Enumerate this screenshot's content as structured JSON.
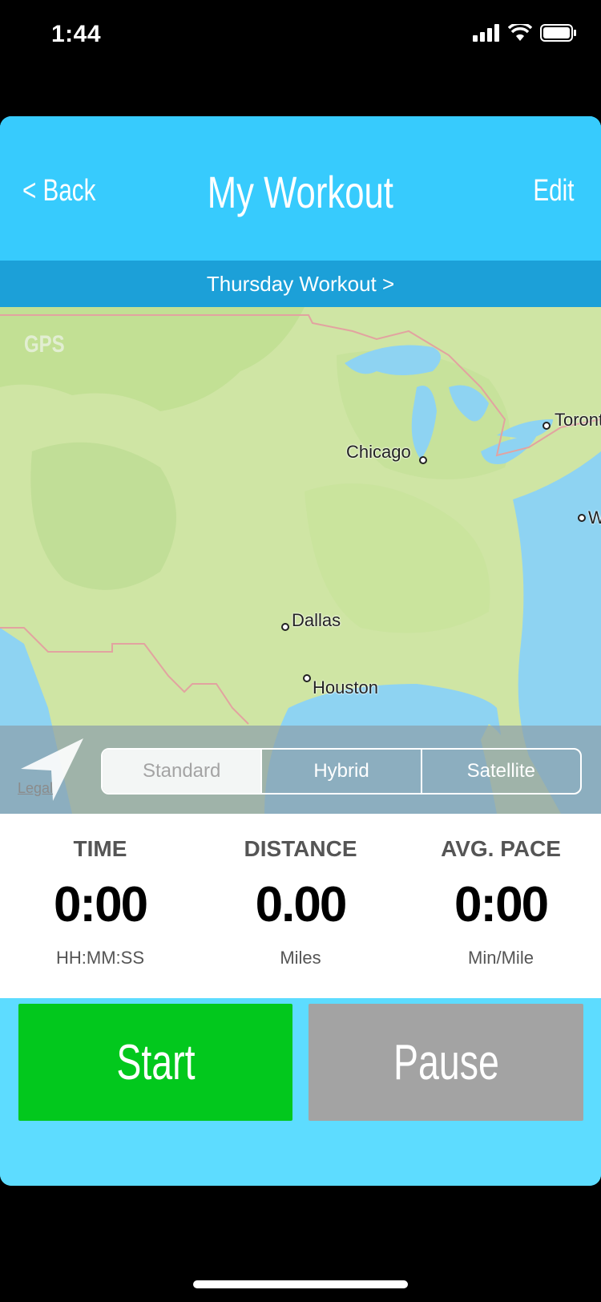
{
  "status_bar": {
    "time": "1:44",
    "icons": [
      "signal-icon",
      "wifi-icon",
      "battery-icon"
    ]
  },
  "nav": {
    "back_label": "< Back",
    "title": "My Workout",
    "edit_label": "Edit"
  },
  "workout_selector": {
    "label": "Thursday Workout >"
  },
  "map": {
    "gps_label": "GPS",
    "cities": [
      "Chicago",
      "Toronto",
      "Dallas",
      "Houston",
      "W"
    ],
    "legal_label": "Legal",
    "map_types": [
      "Standard",
      "Hybrid",
      "Satellite"
    ],
    "selected_map_type": "Standard"
  },
  "stats": [
    {
      "label": "TIME",
      "value": "0:00",
      "unit": "HH:MM:SS"
    },
    {
      "label": "DISTANCE",
      "value": "0.00",
      "unit": "Miles"
    },
    {
      "label": "AVG. PACE",
      "value": "0:00",
      "unit": "Min/Mile"
    }
  ],
  "buttons": {
    "start_label": "Start",
    "pause_label": "Pause"
  },
  "colors": {
    "nav_bg": "#37cbfd",
    "subbar_bg": "#1ca0d8",
    "controls_bg": "#5ddcff",
    "start_bg": "#02c81d",
    "pause_bg": "#a3a3a3"
  }
}
